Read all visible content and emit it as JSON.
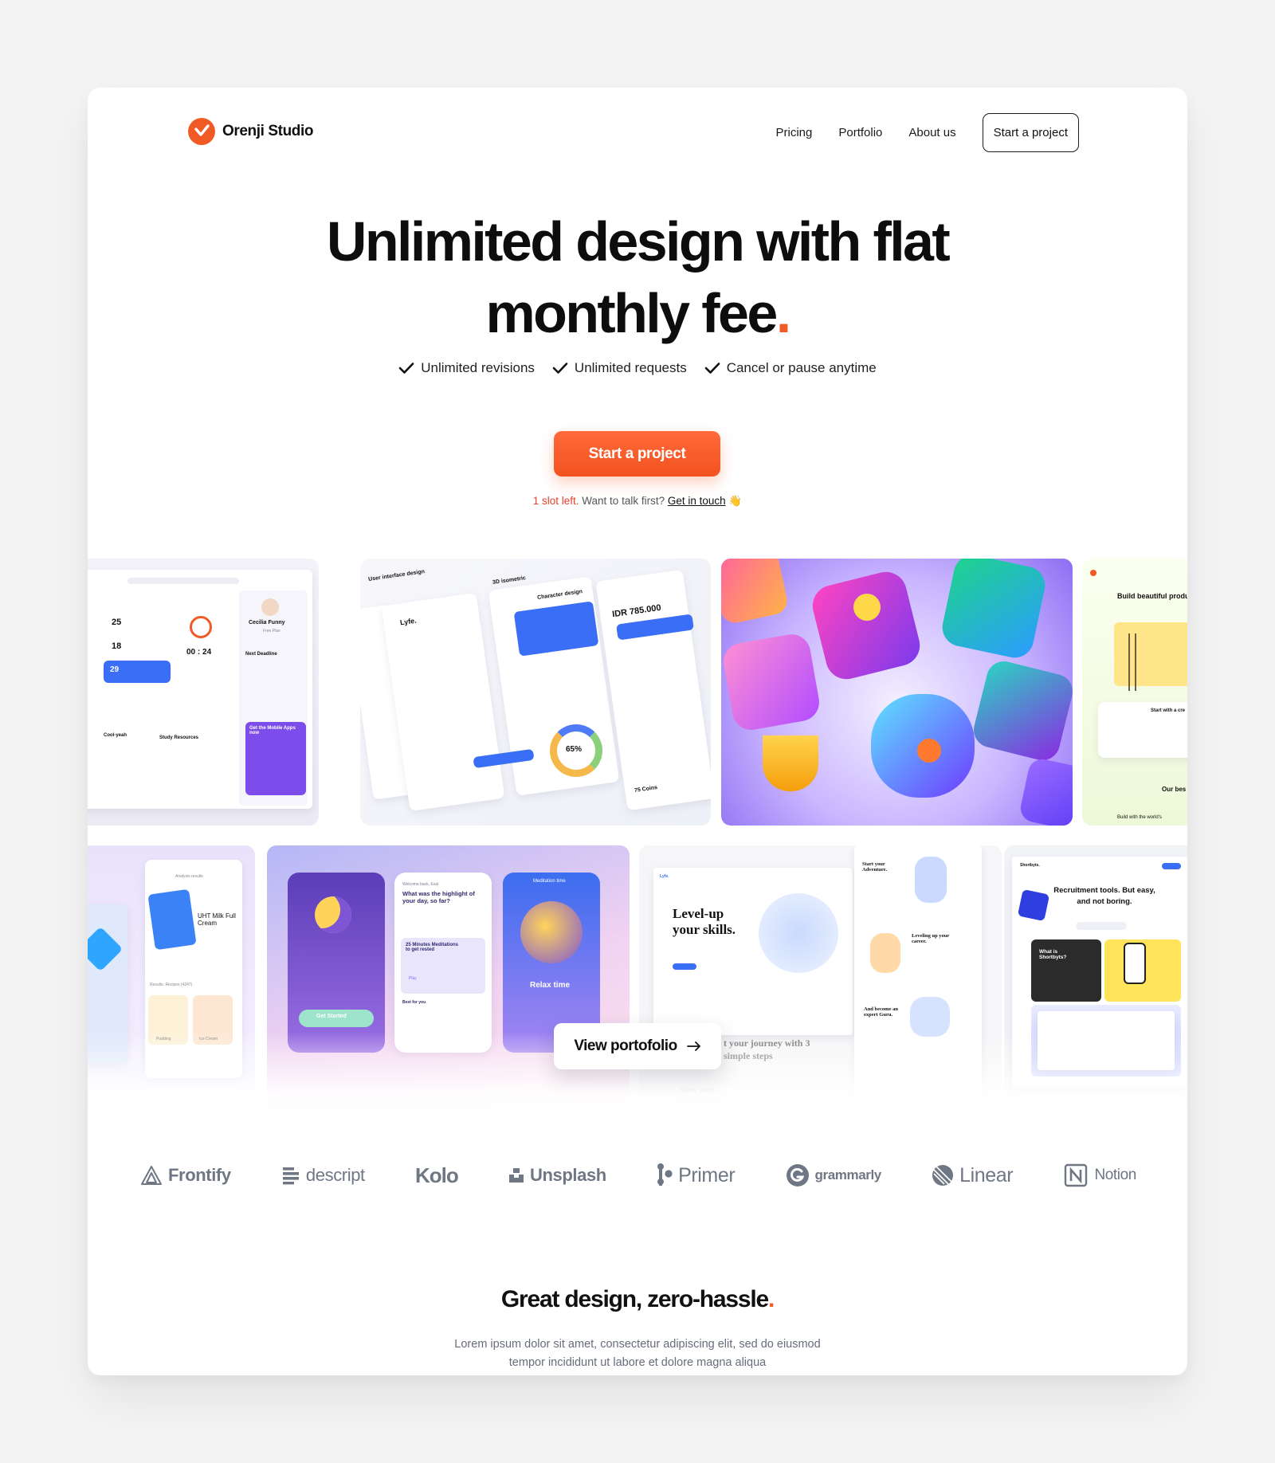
{
  "brand": {
    "name": "Orenji Studio",
    "accent": "#f05a24"
  },
  "nav": {
    "links": [
      "Pricing",
      "Portfolio",
      "About us"
    ],
    "cta": "Start a project"
  },
  "hero": {
    "title_line1": "Unlimited design with flat",
    "title_line2": "monthly fee",
    "title_dot": ".",
    "features": [
      "Unlimited revisions",
      "Unlimited requests",
      "Cancel or pause anytime"
    ],
    "cta": "Start a project",
    "slot_red": "1 slot left.",
    "slot_text": " Want to talk first? ",
    "slot_link": "Get in touch",
    "slot_emoji": "👋"
  },
  "gallery": {
    "tile1": {
      "name_label": "Cecilia Funny",
      "plan": "Free Plan",
      "timer": "00 : 24",
      "deadline": "Next Deadline",
      "mobile": "Get the Mobile Apps now",
      "stat1": "25",
      "stat2": "18",
      "stat3": "29",
      "resources": "Study Resources",
      "cool": "Cool-yeah"
    },
    "tile2": {
      "brand": "Lyfe.",
      "price": "IDR 785.000",
      "pct": "65%",
      "coins": "75 Coins",
      "iso": "3D isometric",
      "char": "Character design",
      "ui": "User interface design"
    },
    "tile4": {
      "headline": "Build beautiful produ",
      "start": "Start with a cre",
      "our": "Our bes",
      "world": "Build with the world's"
    },
    "tile5": {
      "results": "Analysis results",
      "milk": "UHT Milk Full Cream",
      "recipes": "Results: Recipes (4247)",
      "pudding": "Pudding",
      "ice": "Ice Cream"
    },
    "tile6": {
      "welcome": "Welcome back, Eval",
      "question": "What was the highlight of your day, so far?",
      "med": "25 Minutes Meditations to get rested",
      "play": "Play",
      "best": "Best for you",
      "time": "Meditation time",
      "relax": "Relax time",
      "started": "Get Started"
    },
    "tile7": {
      "brand": "Lyfe.",
      "headline": "Level-up your skills.",
      "journey": "t your journey with 3 simple steps",
      "adventure": "Start your Adventure.",
      "leveling": "Leveling up your career.",
      "guru": "And become an expert Guru.",
      "start": "Start your Adventure"
    },
    "tile8": {
      "brand": "Shortbyts.",
      "headline": "Recruitment tools. But easy, and not boring.",
      "what": "What is Shortbyts?"
    },
    "portfolio_button": "View portofolio"
  },
  "clients": [
    "Frontify",
    "descript",
    "Kolo",
    "Unsplash",
    "Primer",
    "grammarly",
    "Linear",
    "Notion"
  ],
  "section": {
    "title": "Great design, zero-hassle",
    "title_dot": ".",
    "body": "Lorem ipsum dolor sit amet, consectetur adipiscing elit, sed do eiusmod tempor incididunt ut labore et dolore magna aliqua"
  }
}
